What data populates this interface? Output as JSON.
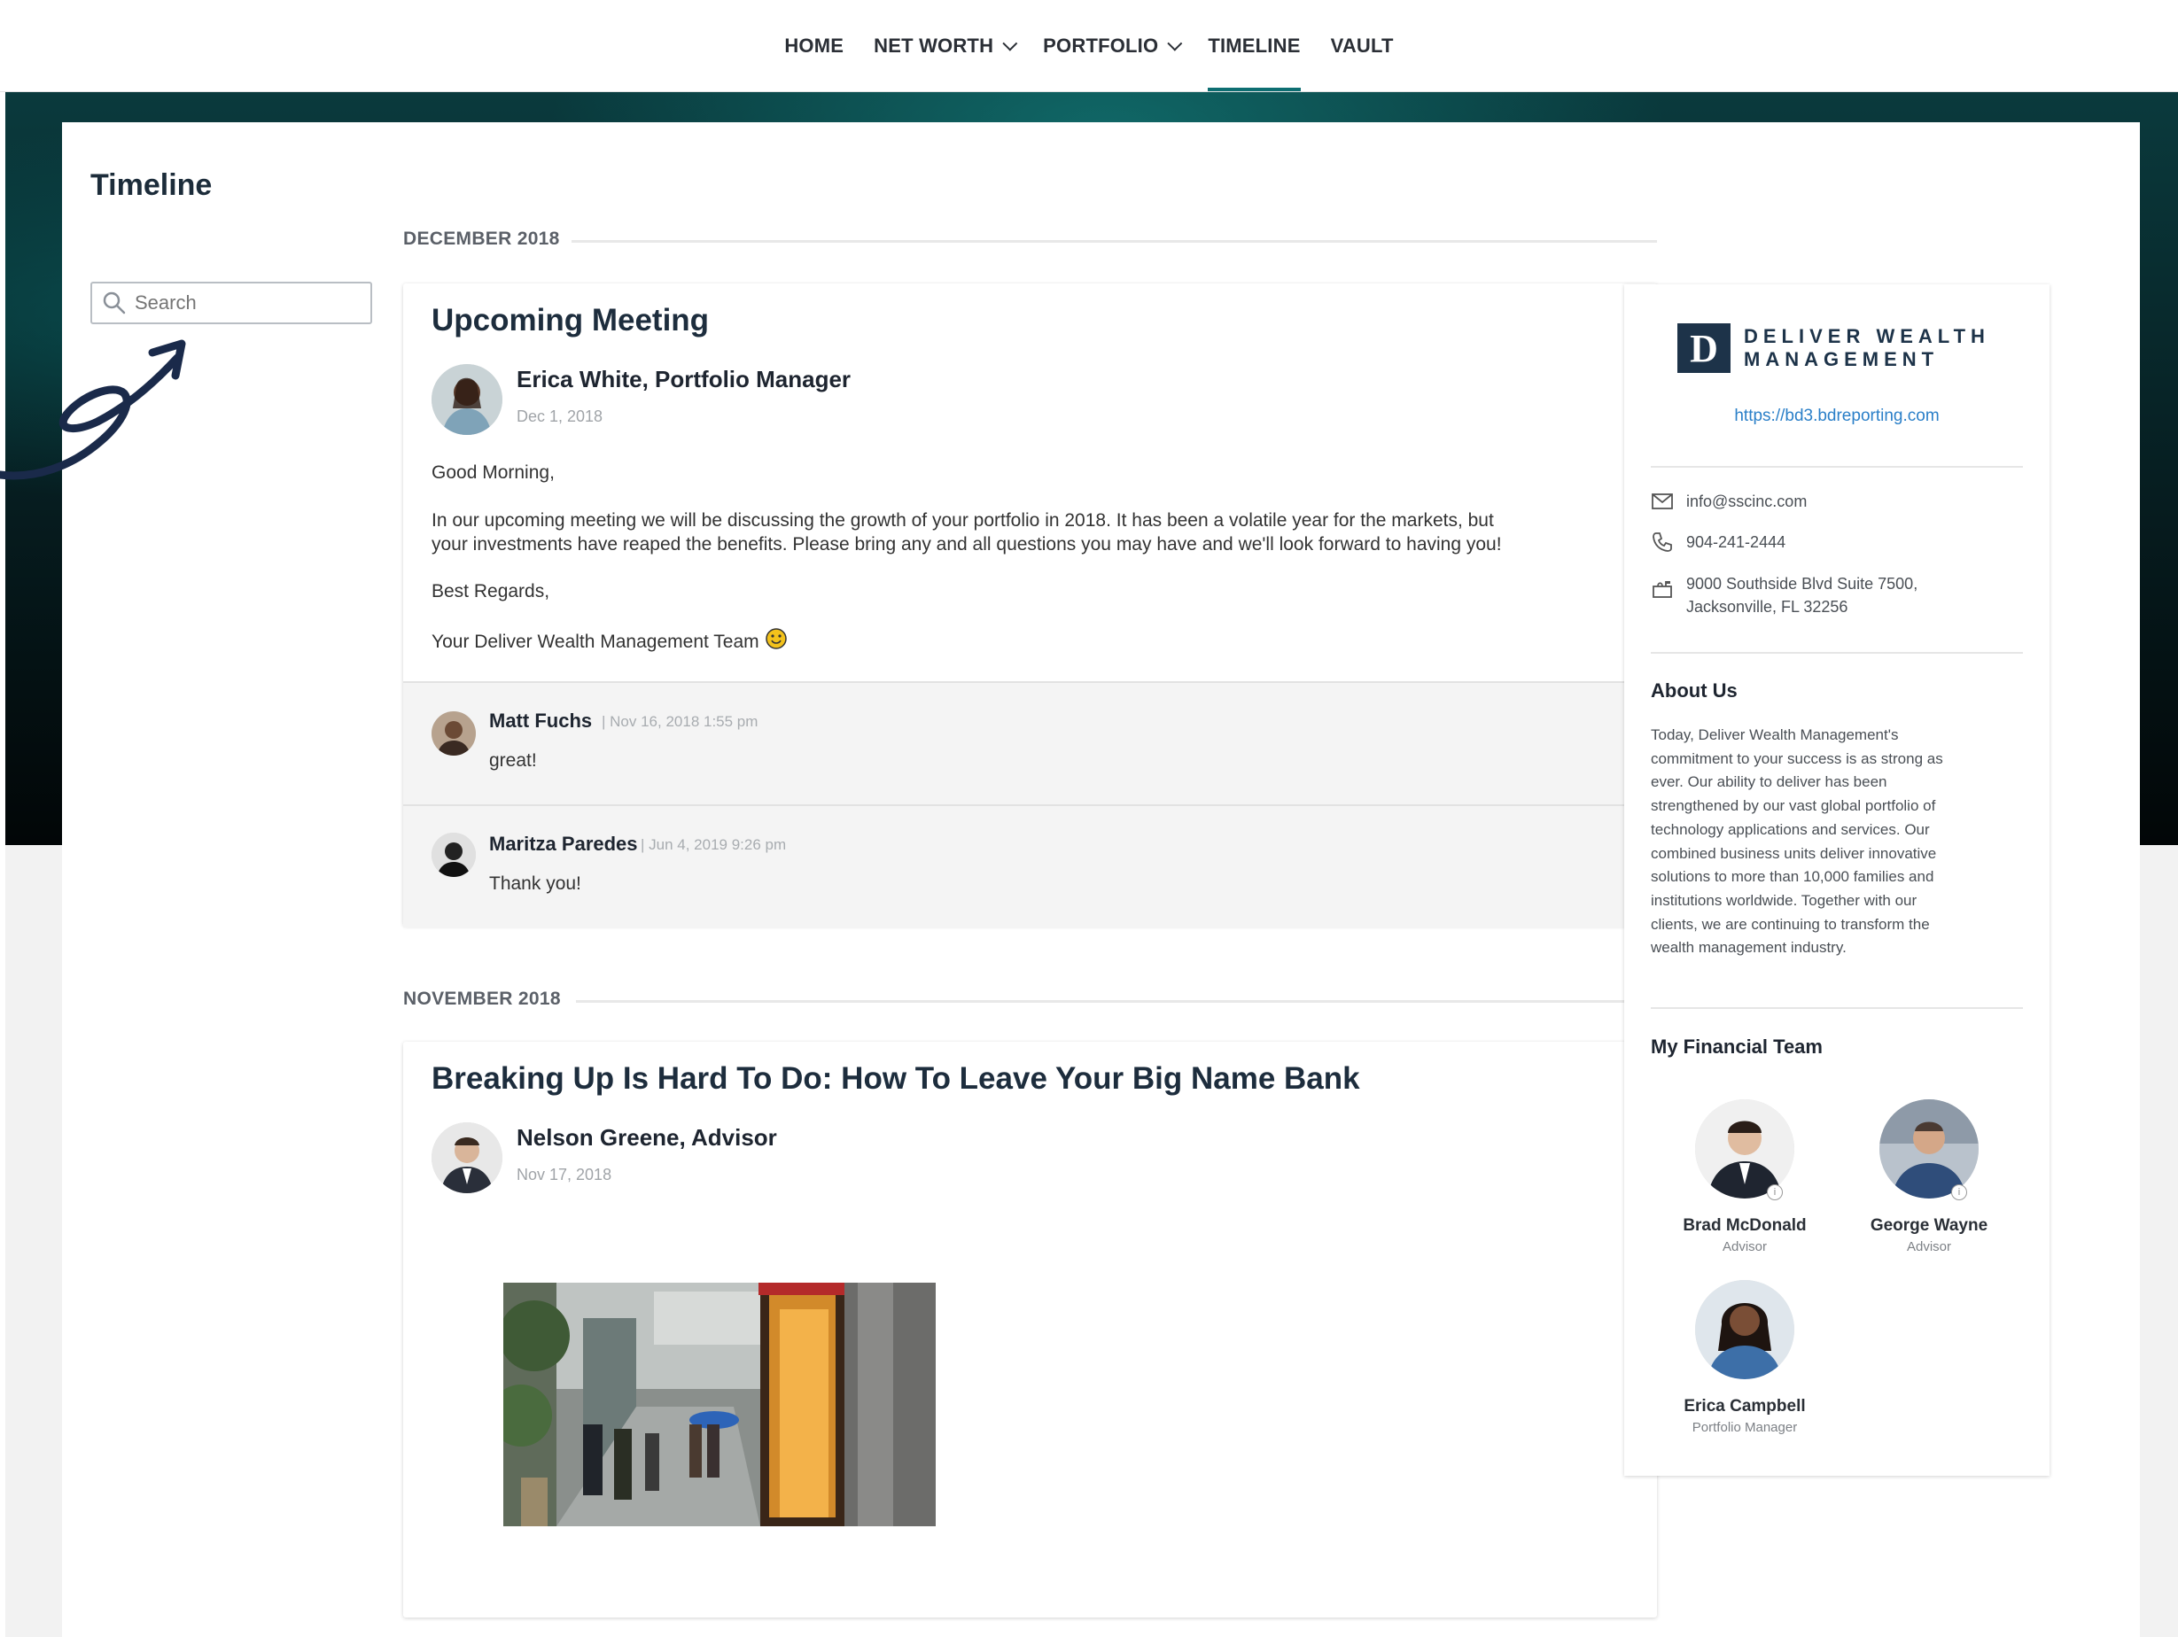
{
  "nav": {
    "items": [
      {
        "label": "HOME"
      },
      {
        "label": "NET WORTH"
      },
      {
        "label": "PORTFOLIO"
      },
      {
        "label": "TIMELINE"
      },
      {
        "label": "VAULT"
      }
    ],
    "active": "TIMELINE"
  },
  "page": {
    "title": "Timeline",
    "search_placeholder": "Search"
  },
  "feed": {
    "months": [
      "DECEMBER 2018",
      "NOVEMBER 2018"
    ],
    "posts": [
      {
        "title": "Upcoming Meeting",
        "author": "Erica White, Portfolio Manager",
        "date": "Dec 1, 2018",
        "greeting": "Good Morning,",
        "body_line1": "In our upcoming meeting we will be discussing the growth of your portfolio in 2018. It has been a volatile year for the markets, but",
        "body_line2": "your investments have reaped the benefits. Please bring any and all questions you may have and we'll look forward to having you!",
        "signoff": "Best Regards,",
        "signature": "Your Deliver Wealth Management Team",
        "comments": [
          {
            "name": "Matt Fuchs",
            "meta": "| Nov 16, 2018 1:55 pm",
            "text": "great!"
          },
          {
            "name": "Maritza Paredes",
            "meta": "| Jun 4, 2019 9:26 pm",
            "text": "Thank you!"
          }
        ]
      },
      {
        "title": "Breaking Up Is Hard To Do: How To Leave Your Big Name Bank",
        "author": "Nelson Greene, Advisor",
        "date": "Nov 17, 2018"
      }
    ]
  },
  "sidebar": {
    "logo_letter": "D",
    "logo_line1": "DELIVER WEALTH",
    "logo_line2": "MANAGEMENT",
    "website": "https://bd3.bdreporting.com",
    "email": "info@sscinc.com",
    "phone": "904-241-2444",
    "address_line1": "9000 Southside Blvd Suite 7500,",
    "address_line2": "Jacksonville, FL 32256",
    "about_heading": "About Us",
    "about_lines": [
      "Today, Deliver Wealth Management's",
      "commitment to your success is as strong as",
      "ever. Our ability to deliver has been",
      "strengthened by our vast global portfolio of",
      "technology applications and services. Our",
      "combined business units deliver innovative",
      "solutions to more than 10,000 families and",
      "institutions worldwide. Together with our",
      "clients, we are continuing to transform the",
      "wealth management industry."
    ],
    "team_heading": "My Financial Team",
    "team": [
      {
        "name": "Brad McDonald",
        "role": "Advisor"
      },
      {
        "name": "George Wayne",
        "role": "Advisor"
      },
      {
        "name": "Erica Campbell",
        "role": "Portfolio Manager"
      }
    ]
  },
  "colors": {
    "accent": "#0d6e72",
    "link": "#2a7fc8",
    "brand_navy": "#1d3349",
    "annotation_arrow": "#1a2a4a"
  }
}
